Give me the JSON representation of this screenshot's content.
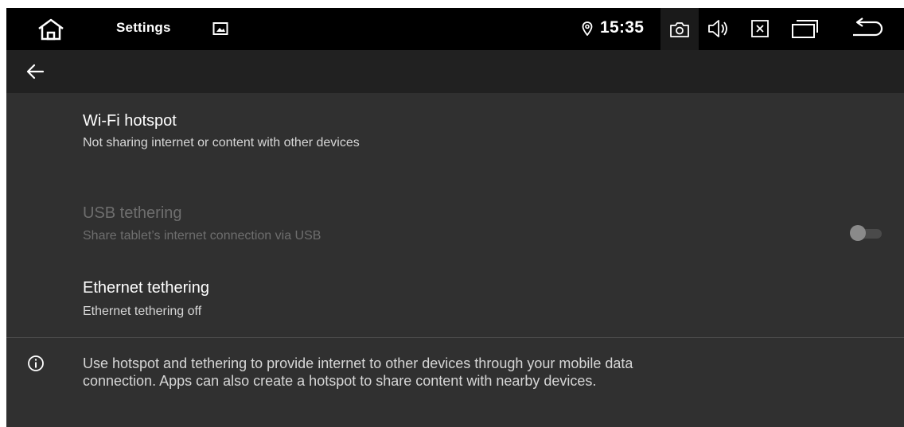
{
  "status_bar": {
    "app_title": "Settings",
    "time": "15:35",
    "icons": [
      "home-icon",
      "gallery-icon",
      "location-icon",
      "camera-icon",
      "volume-icon",
      "close-icon",
      "recents-icon",
      "back-icon"
    ]
  },
  "toolbar": {
    "back_icon": "arrow-left-icon"
  },
  "items": [
    {
      "title": "Wi-Fi hotspot",
      "subtitle": "Not sharing internet or content with other devices",
      "enabled": true
    },
    {
      "title": "USB tethering",
      "subtitle": "Share tablet’s internet connection via USB",
      "enabled": false,
      "toggle": "off"
    },
    {
      "title": "Ethernet tethering",
      "subtitle": "Ethernet tethering off",
      "enabled": true
    }
  ],
  "footer": {
    "line1": "Use hotspot and tethering to provide internet to other devices through your mobile data",
    "line2": "connection. Apps can also create a hotspot to share content with nearby devices."
  },
  "colors": {
    "background": "#303030",
    "status_bar": "#000000",
    "toolbar": "#212121",
    "primary_text": "#ffffff",
    "secondary_text": "#d6d6d6",
    "disabled_text": "#6e6e6e"
  }
}
